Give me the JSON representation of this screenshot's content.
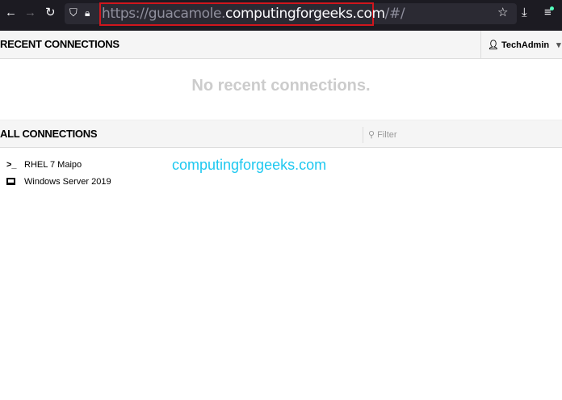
{
  "browser": {
    "url_prefix": "https://guacamole.",
    "url_domain": "computingforgeeks.com",
    "url_suffix": "/#/"
  },
  "recent": {
    "title": "RECENT CONNECTIONS",
    "empty_text": "No recent connections."
  },
  "user": {
    "name": "TechAdmin"
  },
  "all": {
    "title": "ALL CONNECTIONS",
    "filter_placeholder": "Filter",
    "connections": [
      {
        "name": "RHEL 7 Maipo",
        "icon": "terminal-icon"
      },
      {
        "name": "Windows Server 2019",
        "icon": "monitor-icon"
      }
    ]
  },
  "watermark": "computingforgeeks.com"
}
